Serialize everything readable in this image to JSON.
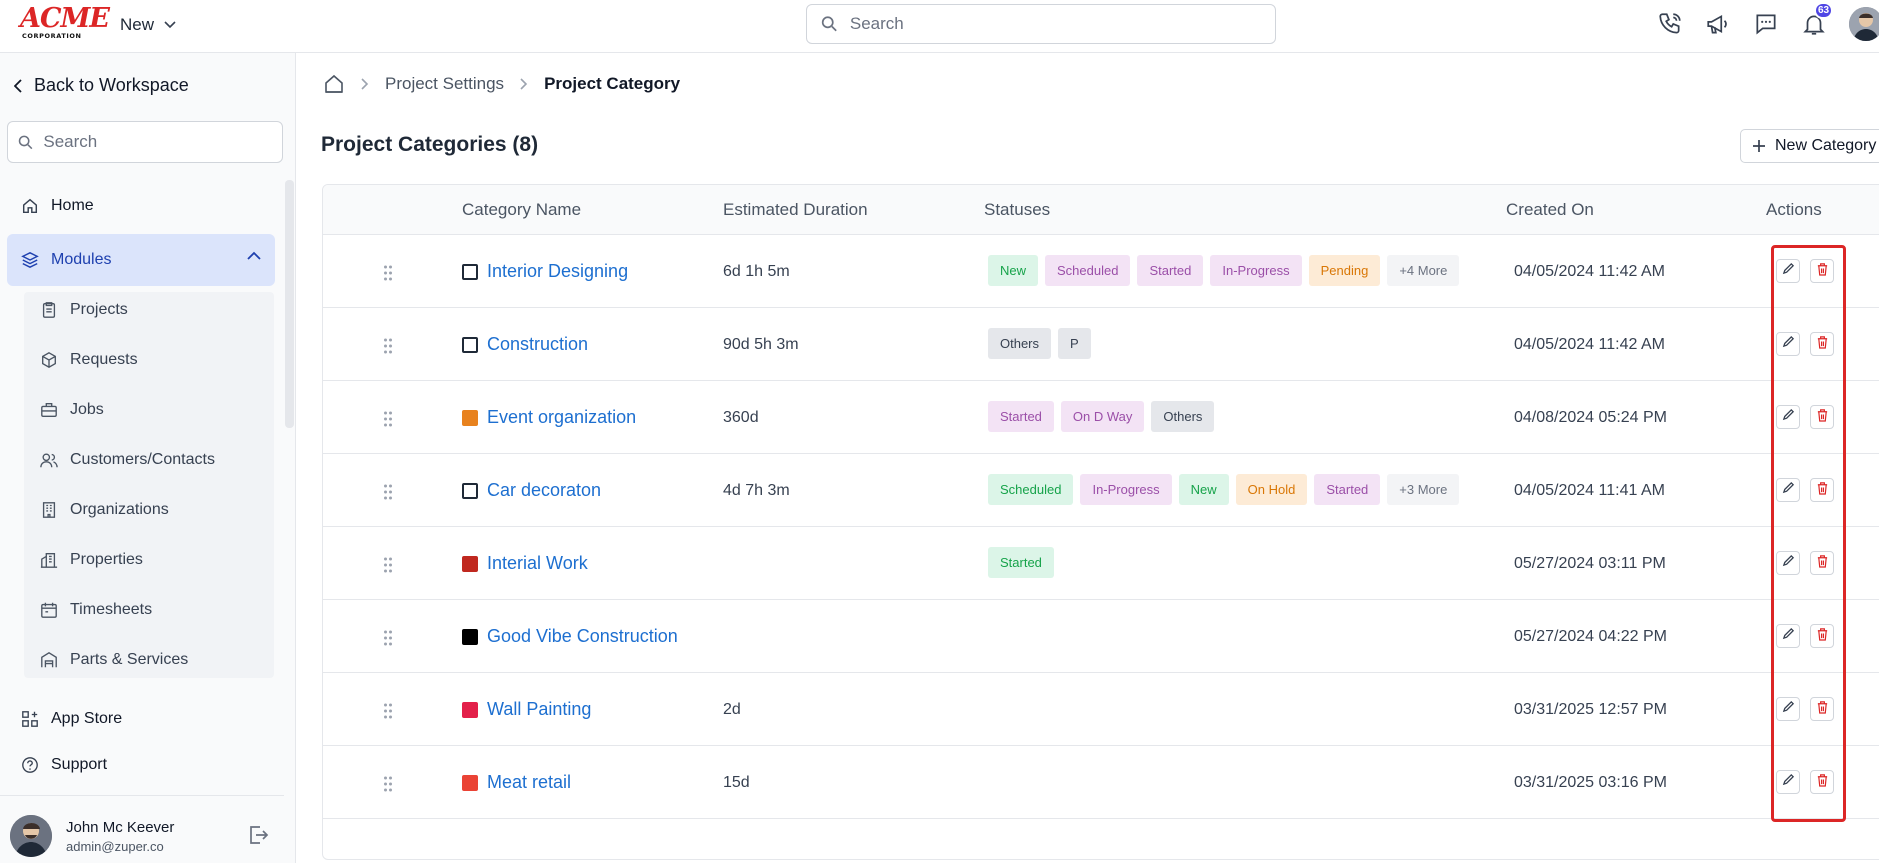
{
  "brand": {
    "name": "ACME",
    "subtitle": "CORPORATION"
  },
  "topbar": {
    "new_label": "New",
    "search_placeholder": "Search",
    "notification_count": "63"
  },
  "sidebar": {
    "back_label": "Back to Workspace",
    "search_placeholder": "Search",
    "home": "Home",
    "modules": "Modules",
    "sub_items": [
      "Projects",
      "Requests",
      "Jobs",
      "Customers/Contacts",
      "Organizations",
      "Properties",
      "Timesheets",
      "Parts & Services"
    ],
    "app_store": "App Store",
    "support": "Support",
    "user": {
      "name": "John Mc Keever",
      "email": "admin@zuper.co"
    }
  },
  "breadcrumb": {
    "level1": "Project Settings",
    "current": "Project Category"
  },
  "page": {
    "title": "Project Categories (8)",
    "new_button": "New Category"
  },
  "table": {
    "headers": {
      "name": "Category Name",
      "duration": "Estimated Duration",
      "statuses": "Statuses",
      "created": "Created On",
      "actions": "Actions"
    },
    "rows": [
      {
        "name": "Interior Designing",
        "color": "none",
        "duration": "6d 1h 5m",
        "statuses": [
          {
            "label": "New",
            "bg": "#dcf5e8",
            "fg": "#16a34a"
          },
          {
            "label": "Scheduled",
            "bg": "#f3e3f5",
            "fg": "#9b4fa8"
          },
          {
            "label": "Started",
            "bg": "#f3e3f5",
            "fg": "#9b4fa8"
          },
          {
            "label": "In-Progress",
            "bg": "#f3e3f5",
            "fg": "#9b4fa8"
          },
          {
            "label": "Pending",
            "bg": "#fdebd6",
            "fg": "#d97706"
          },
          {
            "label": "+4 More",
            "bg": "#f3f4f6",
            "fg": "#6b7280"
          }
        ],
        "created": "04/05/2024 11:42 AM"
      },
      {
        "name": "Construction",
        "color": "none",
        "duration": "90d 5h 3m",
        "statuses": [
          {
            "label": "Others",
            "bg": "#e5e7eb",
            "fg": "#374151"
          },
          {
            "label": "P",
            "bg": "#e5e7eb",
            "fg": "#374151"
          }
        ],
        "created": "04/05/2024 11:42 AM"
      },
      {
        "name": "Event organization",
        "color": "#e8821e",
        "duration": "360d",
        "statuses": [
          {
            "label": "Started",
            "bg": "#f3e3f5",
            "fg": "#9b4fa8"
          },
          {
            "label": "On D Way",
            "bg": "#f3e3f5",
            "fg": "#9b4fa8"
          },
          {
            "label": "Others",
            "bg": "#e5e7eb",
            "fg": "#374151"
          }
        ],
        "created": "04/08/2024 05:24 PM"
      },
      {
        "name": "Car decoraton",
        "color": "none",
        "duration": "4d 7h 3m",
        "statuses": [
          {
            "label": "Scheduled",
            "bg": "#dcf5e8",
            "fg": "#16a34a"
          },
          {
            "label": "In-Progress",
            "bg": "#f3e3f5",
            "fg": "#9b4fa8"
          },
          {
            "label": "New",
            "bg": "#dcf5e8",
            "fg": "#16a34a"
          },
          {
            "label": "On Hold",
            "bg": "#fdebd6",
            "fg": "#d97706"
          },
          {
            "label": "Started",
            "bg": "#f3e3f5",
            "fg": "#9b4fa8"
          },
          {
            "label": "+3 More",
            "bg": "#f3f4f6",
            "fg": "#6b7280"
          }
        ],
        "created": "04/05/2024 11:41 AM"
      },
      {
        "name": "Interial Work",
        "color": "#c0281f",
        "duration": "",
        "statuses": [
          {
            "label": "Started",
            "bg": "#dcf5e8",
            "fg": "#16a34a"
          }
        ],
        "created": "05/27/2024 03:11 PM"
      },
      {
        "name": "Good Vibe Construction",
        "color": "#000000",
        "duration": "",
        "statuses": [],
        "created": "05/27/2024 04:22 PM"
      },
      {
        "name": "Wall Painting",
        "color": "#e3204a",
        "duration": "2d",
        "statuses": [],
        "created": "03/31/2025 12:57 PM"
      },
      {
        "name": "Meat retail",
        "color": "#ea4335",
        "duration": "15d",
        "statuses": [],
        "created": "03/31/2025 03:16 PM"
      }
    ]
  }
}
